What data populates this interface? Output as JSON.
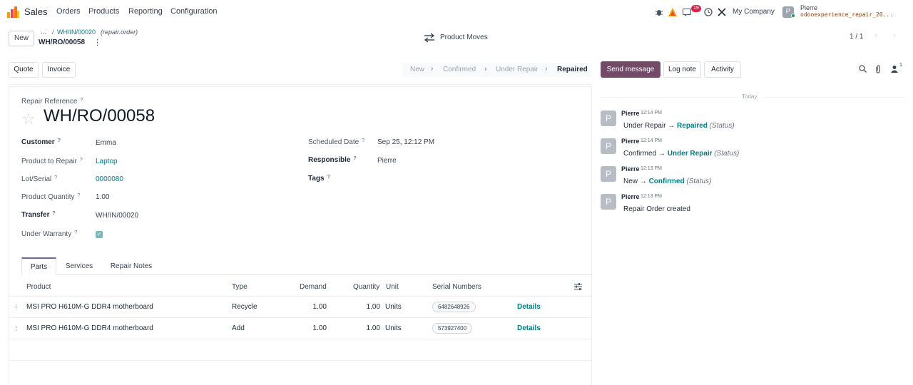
{
  "nav": {
    "app_name": "Sales",
    "menus": [
      "Orders",
      "Products",
      "Reporting",
      "Configuration"
    ],
    "message_count": "19",
    "company": "My Company",
    "user_initial": "P",
    "user_name": "Pierre",
    "database": "odooexperience_repair_20..."
  },
  "control": {
    "new_label": "New",
    "breadcrumb_dots": "...",
    "breadcrumb_sep": "/",
    "breadcrumb_link": "WH/IN/00020",
    "breadcrumb_model": "(repair.order)",
    "record_name": "WH/RO/00058",
    "smart_button": "Product Moves",
    "pager": "1 / 1"
  },
  "statusbar": {
    "actions": [
      "Quote",
      "Invoice"
    ],
    "stages": [
      "New",
      "Confirmed",
      "Under Repair",
      "Repaired"
    ],
    "current_stage": "Repaired"
  },
  "form": {
    "ref_label": "Repair Reference",
    "ref_value": "WH/RO/00058",
    "fields_left": [
      {
        "label": "Customer",
        "value": "Emma"
      },
      {
        "label": "Product to Repair",
        "value": "Laptop"
      },
      {
        "label": "Lot/Serial",
        "value": "0000080"
      },
      {
        "label": "Product Quantity",
        "value": "1.00"
      },
      {
        "label": "Transfer",
        "value": "WH/IN/00020"
      },
      {
        "label": "Under Warranty",
        "value": "✓"
      }
    ],
    "fields_right": [
      {
        "label": "Scheduled Date",
        "value": "Sep 25, 12:12 PM"
      },
      {
        "label": "Responsible",
        "value": "Pierre"
      },
      {
        "label": "Tags",
        "value": ""
      }
    ],
    "help_mark": "?",
    "tabs": [
      "Parts",
      "Services",
      "Repair Notes"
    ],
    "table_headers": [
      "Product",
      "Type",
      "Demand",
      "Quantity",
      "Unit",
      "Serial Numbers"
    ],
    "rows": [
      {
        "product": "MSI PRO H610M-G DDR4 motherboard",
        "type": "Recycle",
        "demand": "1.00",
        "quantity": "1.00",
        "unit": "Units",
        "serial": "6482648926",
        "action": "Details"
      },
      {
        "product": "MSI PRO H610M-G DDR4 motherboard",
        "type": "Add",
        "demand": "1.00",
        "quantity": "1.00",
        "unit": "Units",
        "serial": "573927400",
        "action": "Details"
      }
    ]
  },
  "chatter": {
    "send_message": "Send message",
    "log_note": "Log note",
    "activity": "Activity",
    "follower_count": "1",
    "today": "Today",
    "messages": [
      {
        "initial": "P",
        "author": "Pierre",
        "time": "12:14 PM",
        "old": "Under Repair",
        "arrow": "→",
        "new": "Repaired",
        "field": "(Status)"
      },
      {
        "initial": "P",
        "author": "Pierre",
        "time": "12:14 PM",
        "old": "Confirmed",
        "arrow": "→",
        "new": "Under Repair",
        "field": "(Status)"
      },
      {
        "initial": "P",
        "author": "Pierre",
        "time": "12:13 PM",
        "old": "New",
        "arrow": "→",
        "new": "Confirmed",
        "field": "(Status)"
      },
      {
        "initial": "P",
        "author": "Pierre",
        "time": "12:13 PM",
        "text": "Repair Order created"
      }
    ]
  }
}
